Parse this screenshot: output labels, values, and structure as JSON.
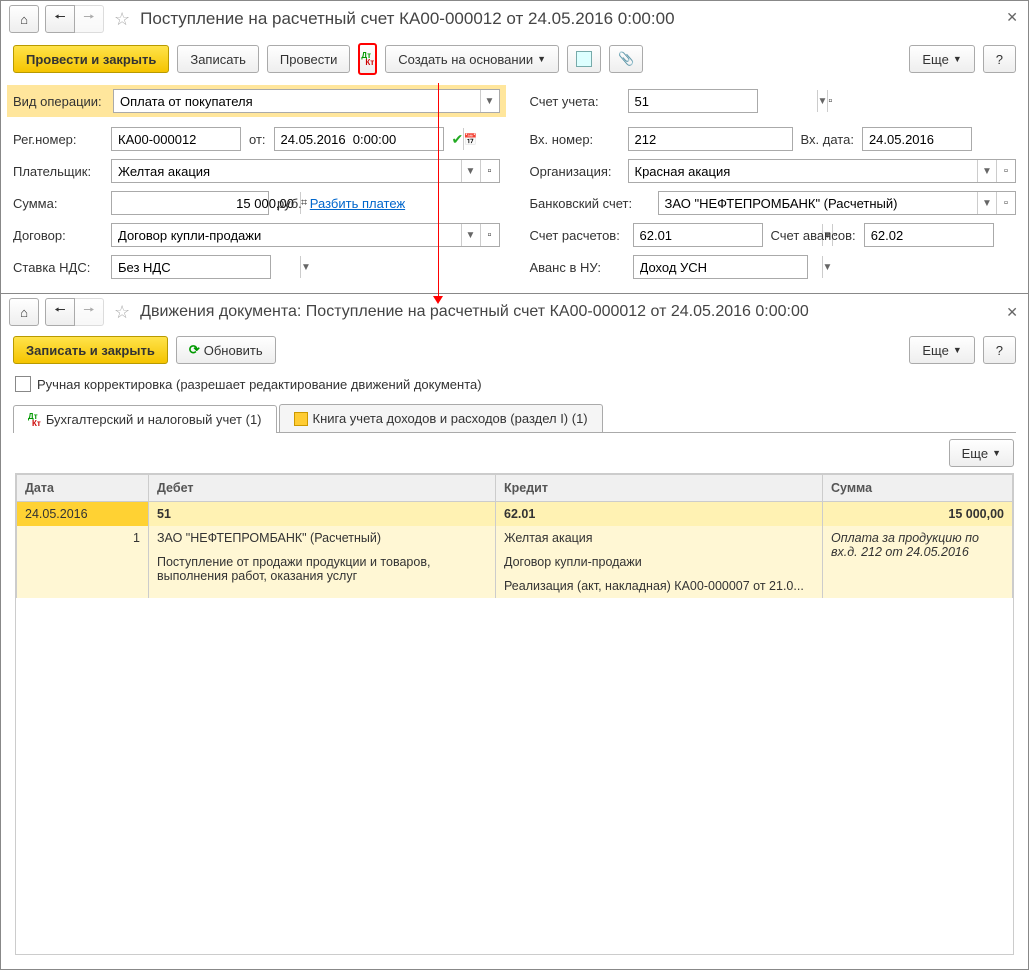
{
  "main": {
    "title": "Поступление на расчетный счет КА00-000012 от 24.05.2016 0:00:00",
    "toolbar": {
      "post_close": "Провести и закрыть",
      "save": "Записать",
      "post": "Провести",
      "create_based": "Создать на основании",
      "more": "Еще",
      "help": "?"
    },
    "fields": {
      "op_type_lbl": "Вид операции:",
      "op_type": "Оплата от покупателя",
      "account_lbl": "Счет учета:",
      "account": "51",
      "reg_no_lbl": "Рег.номер:",
      "reg_no": "КА00-000012",
      "from_lbl": "от:",
      "date": "24.05.2016  0:00:00",
      "in_no_lbl": "Вх. номер:",
      "in_no": "212",
      "in_date_lbl": "Вх. дата:",
      "in_date": "24.05.2016",
      "payer_lbl": "Плательщик:",
      "payer": "Желтая акация",
      "org_lbl": "Организация:",
      "org": "Красная акация",
      "sum_lbl": "Сумма:",
      "sum": "15 000,00",
      "rub": "руб.",
      "split": "Разбить платеж",
      "bank_lbl": "Банковский счет:",
      "bank": "ЗАО \"НЕФТЕПРОМБАНК\" (Расчетный)",
      "contract_lbl": "Договор:",
      "contract": "Договор купли-продажи",
      "settle_lbl": "Счет расчетов:",
      "settle": "62.01",
      "advance_lbl": "Счет авансов:",
      "advance": "62.02",
      "vat_lbl": "Ставка НДС:",
      "vat": "Без НДС",
      "nu_lbl": "Аванс в НУ:",
      "nu": "Доход УСН"
    }
  },
  "sub": {
    "title": "Движения документа: Поступление на расчетный счет КА00-000012 от 24.05.2016 0:00:00",
    "toolbar": {
      "save_close": "Записать и закрыть",
      "refresh": "Обновить",
      "more": "Еще",
      "help": "?"
    },
    "manual": "Ручная корректировка (разрешает редактирование движений документа)",
    "tabs": {
      "accounting": "Бухгалтерский и налоговый учет (1)",
      "book": "Книга учета доходов и расходов (раздел I) (1)"
    },
    "grid_more": "Еще",
    "grid": {
      "headers": {
        "date": "Дата",
        "debit": "Дебет",
        "credit": "Кредит",
        "sum": "Сумма"
      },
      "r1": {
        "date": "24.05.2016",
        "debit": "51",
        "credit": "62.01",
        "sum": "15 000,00"
      },
      "r2": {
        "num": "1",
        "debit1": "ЗАО \"НЕФТЕПРОМБАНК\" (Расчетный)",
        "debit2": "Поступление от продажи продукции и товаров, выполнения работ, оказания услуг",
        "credit1": "Желтая акация",
        "credit2": "Договор купли-продажи",
        "credit3": "Реализация (акт, накладная) КА00-000007 от 21.0...",
        "sum": "Оплата за продукцию по вх.д. 212 от 24.05.2016"
      }
    }
  }
}
